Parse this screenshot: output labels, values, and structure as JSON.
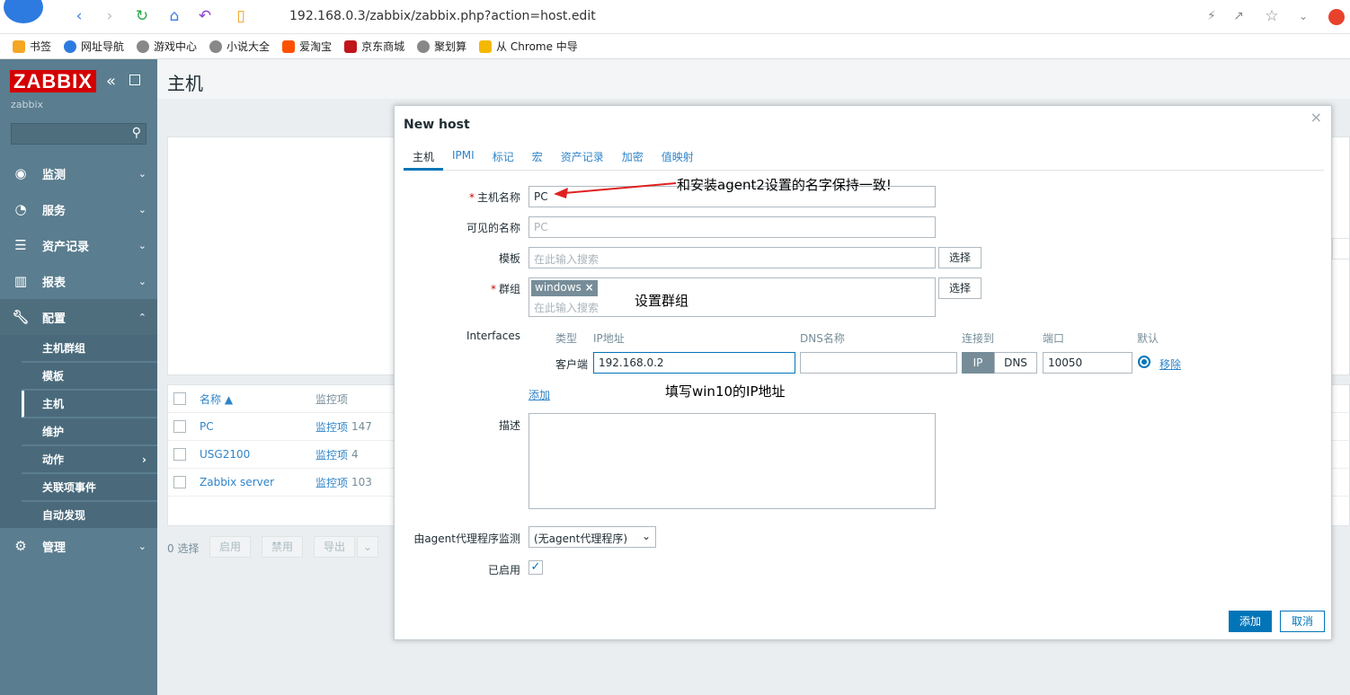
{
  "browser": {
    "url": "192.168.0.3/zabbix/zabbix.php?action=host.edit",
    "bookmarks": [
      "书签",
      "网址导航",
      "游戏中心",
      "小说大全",
      "爱淘宝",
      "京东商城",
      "聚划算",
      "从 Chrome 中导"
    ]
  },
  "sidebar": {
    "logo": "ZABBIX",
    "server_name": "zabbix",
    "menu": [
      {
        "label": "监测",
        "icon": "eye-icon"
      },
      {
        "label": "服务",
        "icon": "clock-icon"
      },
      {
        "label": "资产记录",
        "icon": "list-icon"
      },
      {
        "label": "报表",
        "icon": "bar-chart-icon"
      },
      {
        "label": "配置",
        "icon": "wrench-icon"
      },
      {
        "label": "管理",
        "icon": "gear-icon"
      }
    ],
    "submenu": [
      "主机群组",
      "模板",
      "主机",
      "维护",
      "动作",
      "关联项事件",
      "自动发现"
    ]
  },
  "main": {
    "title": "主机",
    "list": {
      "col_name": "名称 ▲",
      "col_items": "监控项",
      "rows": [
        {
          "name": "PC",
          "items_label": "监控项",
          "items_count": "147"
        },
        {
          "name": "USG2100",
          "items_label": "监控项",
          "items_count": "4"
        },
        {
          "name": "Zabbix server",
          "items_label": "监控项",
          "items_count": "103"
        }
      ]
    },
    "footer": {
      "selected": "0 选择",
      "enable": "启用",
      "disable": "禁用",
      "export": "导出"
    }
  },
  "modal": {
    "title": "New host",
    "tabs": [
      "主机",
      "IPMI",
      "标记",
      "宏",
      "资产记录",
      "加密",
      "值映射"
    ],
    "host_name_label": "主机名称",
    "host_name_value": "PC",
    "visible_name_label": "可见的名称",
    "visible_name_placeholder": "PC",
    "templates_label": "模板",
    "search_placeholder": "在此输入搜索",
    "select_button": "选择",
    "groups_label": "群组",
    "group_tag": "windows",
    "interfaces_label": "Interfaces",
    "iface_headers": {
      "type": "类型",
      "ip": "IP地址",
      "dns": "DNS名称",
      "connect": "连接到",
      "port": "端口",
      "default": "默认"
    },
    "iface_row": {
      "type": "客户端",
      "ip": "192.168.0.2",
      "dns": "",
      "ip_btn": "IP",
      "dns_btn": "DNS",
      "port": "10050",
      "remove": "移除"
    },
    "add_link": "添加",
    "description_label": "描述",
    "proxy_label": "由agent代理程序监测",
    "proxy_value": "(无agent代理程序)",
    "enabled_label": "已启用",
    "add_button": "添加",
    "cancel_button": "取消"
  },
  "annotations": {
    "hostname_note": "和安装agent2设置的名字保持一致!",
    "group_note": "设置群组",
    "ip_note": "填写win10的IP地址"
  },
  "colors": {
    "accent": "#0275b8",
    "sidebar": "#5a7d8f",
    "logo": "#d40000",
    "annotation_arrow": "#e02020"
  }
}
